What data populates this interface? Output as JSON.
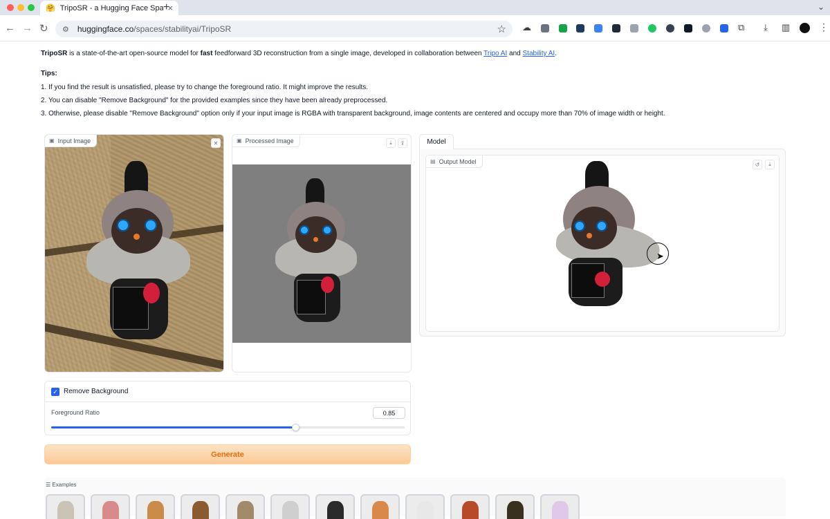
{
  "browser": {
    "tab_title": "TripoSR - a Hugging Face Space",
    "tab_favicon": "🤗",
    "url_host": "huggingface.co",
    "url_path": "/spaces/stabilityai/TripoSR",
    "traffic_colors": [
      "#ff5f57",
      "#febc2e",
      "#28c840"
    ]
  },
  "intro": {
    "brand": "TripoSR",
    "text_a": " is a state-of-the-art open-source model for ",
    "bold": "fast",
    "text_b": " feedforward 3D reconstruction from a single image, developed in collaboration between ",
    "link1": "Tripo AI",
    "text_c": " and ",
    "link2": "Stability AI",
    "text_d": "."
  },
  "tips": {
    "heading": "Tips:",
    "items": [
      "1. If you find the result is unsatisfied, please try to change the foreground ratio. It might improve the results.",
      "2. You can disable \"Remove Background\" for the provided examples since they have been already preprocessed.",
      "3. Otherwise, please disable \"Remove Background\" option only if your input image is RGBA with transparent background, image contents are centered and occupy more than 70% of image width or height."
    ]
  },
  "input_image": {
    "label": "Input Image"
  },
  "processed_image": {
    "label": "Processed Image"
  },
  "controls": {
    "remove_background_label": "Remove Background",
    "remove_background_checked": true,
    "foreground_ratio_label": "Foreground Ratio",
    "foreground_ratio_value": "0.85",
    "foreground_ratio_fraction": 0.69
  },
  "generate_label": "Generate",
  "model": {
    "tab_label": "Model",
    "output_label": "Output Model"
  },
  "examples": {
    "label": "Examples",
    "thumb_colors": [
      "#c9c2b5",
      "#d98b8b",
      "#c98a4a",
      "#8a5a30",
      "#a08a6a",
      "#cfcfcf",
      "#2a2a2a",
      "#d9894a",
      "#e8e8e8",
      "#b84a2a",
      "#3a3020",
      "#e0c8e8"
    ]
  },
  "colors": {
    "accent": "#2563eb",
    "generate_text": "#ea6c0a"
  }
}
